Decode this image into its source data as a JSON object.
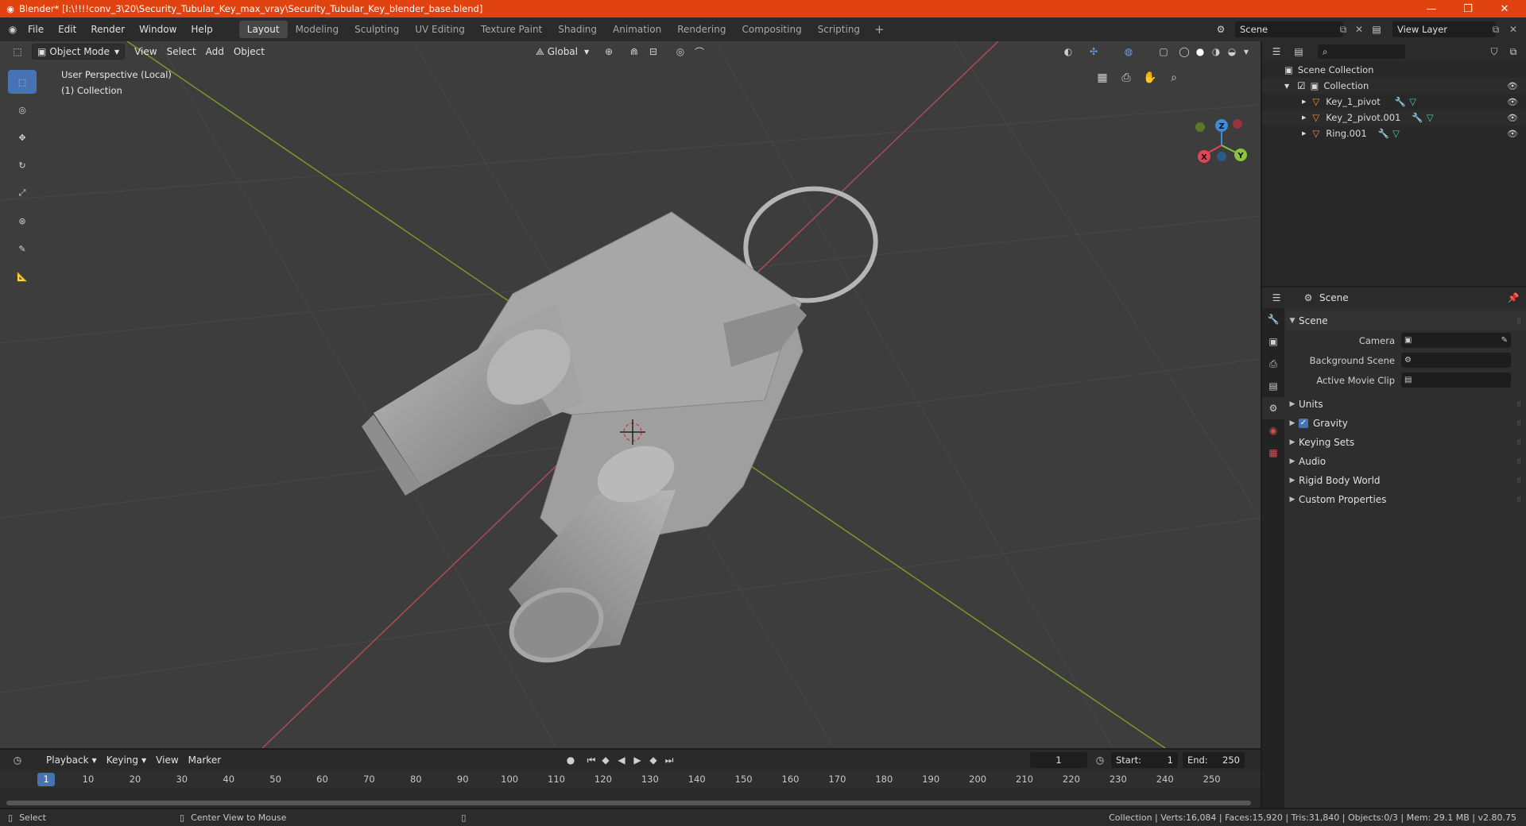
{
  "window": {
    "title": "Blender* [I:\\!!!!conv_3\\20\\Security_Tubular_Key_max_vray\\Security_Tubular_Key_blender_base.blend]",
    "controls": [
      "—",
      "❐",
      "✕"
    ]
  },
  "menu": [
    "File",
    "Edit",
    "Render",
    "Window",
    "Help"
  ],
  "workspaces": [
    {
      "label": "Layout",
      "active": true
    },
    {
      "label": "Modeling"
    },
    {
      "label": "Sculpting"
    },
    {
      "label": "UV Editing"
    },
    {
      "label": "Texture Paint"
    },
    {
      "label": "Shading"
    },
    {
      "label": "Animation"
    },
    {
      "label": "Rendering"
    },
    {
      "label": "Compositing"
    },
    {
      "label": "Scripting"
    }
  ],
  "scene_field": "Scene",
  "view_layer_field": "View Layer",
  "viewport": {
    "mode": "Object Mode",
    "menus": [
      "View",
      "Select",
      "Add",
      "Object"
    ],
    "orientation": "Global",
    "info_line1": "User Perspective (Local)",
    "info_line2": "(1) Collection",
    "gizmo": {
      "x": "X",
      "y": "Y",
      "z": "Z"
    }
  },
  "outliner": {
    "root": "Scene Collection",
    "collection": "Collection",
    "objects": [
      "Key_1_pivot",
      "Key_2_pivot.001",
      "Ring.001"
    ]
  },
  "properties": {
    "header": "Scene",
    "panel_title": "Scene",
    "fields": [
      {
        "label": "Camera"
      },
      {
        "label": "Background Scene"
      },
      {
        "label": "Active Movie Clip"
      }
    ],
    "sections": [
      "Units",
      "Gravity",
      "Keying Sets",
      "Audio",
      "Rigid Body World",
      "Custom Properties"
    ]
  },
  "timeline": {
    "menus": [
      "Playback",
      "Keying",
      "View",
      "Marker"
    ],
    "current_frame": "1",
    "start_label": "Start:",
    "start": "1",
    "end_label": "End:",
    "end": "250",
    "ticks": [
      "1",
      "10",
      "20",
      "30",
      "40",
      "50",
      "60",
      "70",
      "80",
      "90",
      "100",
      "110",
      "120",
      "130",
      "140",
      "150",
      "160",
      "170",
      "180",
      "190",
      "200",
      "210",
      "220",
      "230",
      "240",
      "250"
    ]
  },
  "status": {
    "select": "Select",
    "center_view": "Center View to Mouse",
    "stats": "Collection | Verts:16,084 | Faces:15,920 | Tris:31,840 | Objects:0/3 | Mem: 29.1 MB | v2.80.75"
  },
  "colors": {
    "title_bar": "#e0430f",
    "accent": "#4772b3",
    "x_axis": "#e04455",
    "y_axis": "#8cc43a",
    "z_axis": "#3d8bd9"
  }
}
